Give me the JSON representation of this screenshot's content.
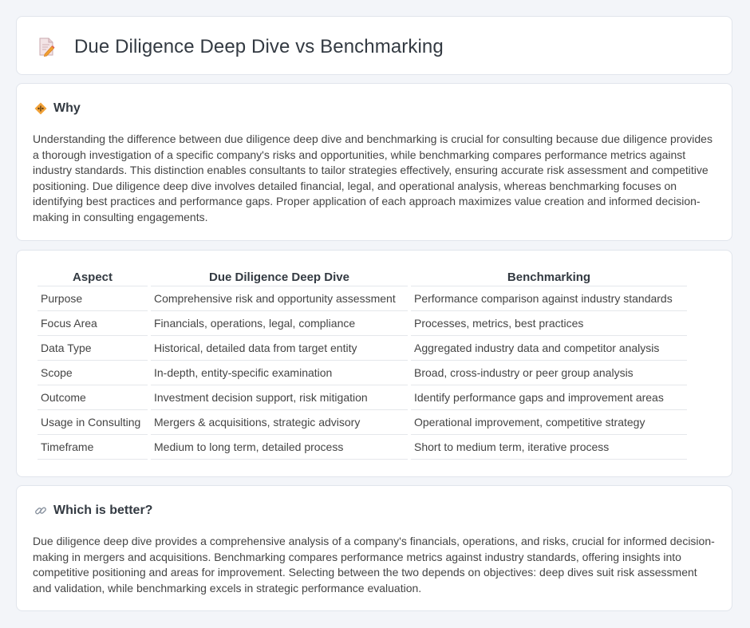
{
  "header": {
    "title": "Due Diligence Deep Dive vs Benchmarking",
    "icon": "document-pencil-icon"
  },
  "why": {
    "icon": "diamond-warning-icon",
    "title": "Why",
    "body": "Understanding the difference between due diligence deep dive and benchmarking is crucial for consulting because due diligence provides a thorough investigation of a specific company's risks and opportunities, while benchmarking compares performance metrics against industry standards. This distinction enables consultants to tailor strategies effectively, ensuring accurate risk assessment and competitive positioning. Due diligence deep dive involves detailed financial, legal, and operational analysis, whereas benchmarking focuses on identifying best practices and performance gaps. Proper application of each approach maximizes value creation and informed decision-making in consulting engagements."
  },
  "comparison": {
    "headers": [
      "Aspect",
      "Due Diligence Deep Dive",
      "Benchmarking"
    ],
    "rows": [
      [
        "Purpose",
        "Comprehensive risk and opportunity assessment",
        "Performance comparison against industry standards"
      ],
      [
        "Focus Area",
        "Financials, operations, legal, compliance",
        "Processes, metrics, best practices"
      ],
      [
        "Data Type",
        "Historical, detailed data from target entity",
        "Aggregated industry data and competitor analysis"
      ],
      [
        "Scope",
        "In-depth, entity-specific examination",
        "Broad, cross-industry or peer group analysis"
      ],
      [
        "Outcome",
        "Investment decision support, risk mitigation",
        "Identify performance gaps and improvement areas"
      ],
      [
        "Usage in Consulting",
        "Mergers & acquisitions, strategic advisory",
        "Operational improvement, competitive strategy"
      ],
      [
        "Timeframe",
        "Medium to long term, detailed process",
        "Short to medium term, iterative process"
      ]
    ]
  },
  "better": {
    "icon": "link-icon",
    "title": "Which is better?",
    "body": "Due diligence deep dive provides a comprehensive analysis of a company's financials, operations, and risks, crucial for informed decision-making in mergers and acquisitions. Benchmarking compares performance metrics against industry standards, offering insights into competitive positioning and areas for improvement. Selecting between the two depends on objectives: deep dives suit risk assessment and validation, while benchmarking excels in strategic performance evaluation."
  }
}
